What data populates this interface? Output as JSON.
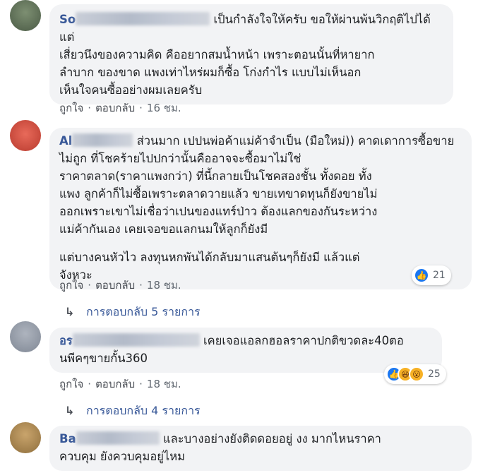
{
  "comments": [
    {
      "author_visible": "So",
      "paragraphs": [
        "เป็นกำลังใจให้ครับ ขอให้ผ่านพ้นวิกฤติไปได้ แต่",
        "เสี่ยวนึงของความคิด คืออยากสมน้ำหน้า เพราะตอนนั้นที่หายาก\nลำบาก ของขาด แพงเท่าไหร่ผมก็ซื้อ โก่งกำไร แบบไม่เห็นอก\nเห็นใจคนซื้ออย่างผมเลยครับ"
      ],
      "like": "ถูกใจ",
      "reply": "ตอบกลับ",
      "time": "16 ชม."
    },
    {
      "author_visible": "Al",
      "paragraphs": [
        "ส่วนมาก เปปนพ่อค้าแม่ค้าจำเป็น (มือใหม่)) คาดเดาการซื้อขายไม่ถูก ที่โชคร้ายไปปกว่านั้นคืออาจจะซื้อมาไม่ใช่\nราคาตลาด(ราคาแพงกว่า) ที่นี้กลายเป็นโชคสองชั้น ทั้งดอย ทั้ง\nแพง ลูกค้าก็ไม่ซื้อเพราะตลาดวายแล้ว ขายเทขาดทุนก็ยังขายไม่\nออกเพราะเขาไม่เชื่อว่าเปนของแทร์ป่าว ต้องแลกของกันระหว่าง\nแม่ค้ากันเอง เคยเจอขอแลกนมให้ลูกก็ยังมี",
        "แต่บางคนหัวไว ลงทุนหกพันได้กลับมาแสนต้นๆก็ยังมี แล้วแต่\nจังหวะ"
      ],
      "like": "ถูกใจ",
      "reply": "ตอบกลับ",
      "time": "18 ชม.",
      "reaction_count": "21",
      "replies_label": "การตอบกลับ 5 รายการ"
    },
    {
      "author_visible": "อร",
      "paragraphs": [
        "เคยเจอแอลกฮอลราคาปกติขวดละ40ตอนพีคๆขายกั้น360"
      ],
      "like": "ถูกใจ",
      "reply": "ตอบกลับ",
      "time": "18 ชม.",
      "reaction_count": "25",
      "replies_label": "การตอบกลับ 4 รายการ"
    },
    {
      "author_visible": "Ba",
      "paragraphs": [
        "และบางอย่างยังติดดอยอยู่ งง มากไหนราคา\nควบคุม ยังควบคุมอยู่ไหม"
      ]
    }
  ],
  "separator": "·",
  "colors": {
    "link": "#385898",
    "bubble": "#f2f3f5",
    "meta": "#606770",
    "like": "#1a77f2",
    "haha": "#f7b125"
  },
  "icons": {
    "reply_arrow": "reply-arrow-icon",
    "like": "like-reaction-icon",
    "haha": "haha-reaction-icon",
    "wow": "wow-reaction-icon"
  }
}
